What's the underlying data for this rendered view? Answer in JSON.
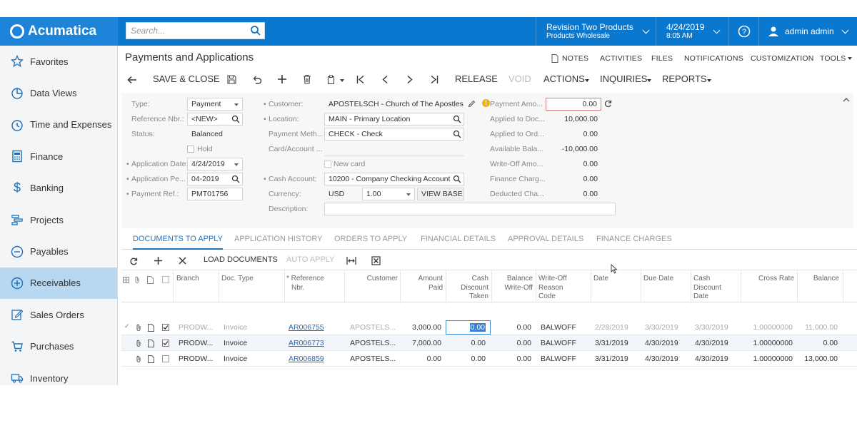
{
  "topbar": {
    "brand": "Acumatica",
    "search_placeholder": "Search...",
    "company_line1": "Revision Two Products",
    "company_line2": "Products Wholesale",
    "date_line1": "4/24/2019",
    "date_line2": "8:05 AM",
    "user": "admin admin"
  },
  "sidebar": {
    "items": [
      {
        "label": "Favorites",
        "icon": "star-icon"
      },
      {
        "label": "Data Views",
        "icon": "pie-chart-icon"
      },
      {
        "label": "Time and Expenses",
        "icon": "clock-icon"
      },
      {
        "label": "Finance",
        "icon": "calculator-icon"
      },
      {
        "label": "Banking",
        "icon": "dollar-icon"
      },
      {
        "label": "Projects",
        "icon": "projects-icon"
      },
      {
        "label": "Payables",
        "icon": "minus-circle-icon"
      },
      {
        "label": "Receivables",
        "icon": "plus-circle-icon"
      },
      {
        "label": "Sales Orders",
        "icon": "edit-icon"
      },
      {
        "label": "Purchases",
        "icon": "cart-icon"
      },
      {
        "label": "Inventory",
        "icon": "truck-icon"
      }
    ]
  },
  "page": {
    "title": "Payments and Applications",
    "utils": [
      "NOTES",
      "ACTIVITIES",
      "FILES",
      "NOTIFICATIONS",
      "CUSTOMIZATION",
      "TOOLS"
    ]
  },
  "toolbar": {
    "save_close": "SAVE & CLOSE",
    "release": "RELEASE",
    "void": "VOID",
    "actions": "ACTIONS",
    "inquiries": "INQUIRIES",
    "reports": "REPORTS"
  },
  "form": {
    "type_label": "Type:",
    "type_value": "Payment",
    "refnbr_label": "Reference Nbr.:",
    "refnbr_value": "<NEW>",
    "status_label": "Status:",
    "status_value": "Balanced",
    "hold_label": "Hold",
    "appdate_label": "Application Date:",
    "appdate_value": "4/24/2019",
    "appperiod_label": "Application Pe...",
    "appperiod_value": "04-2019",
    "payref_label": "Payment Ref.:",
    "payref_value": "PMT01756",
    "customer_label": "Customer:",
    "customer_value": "APOSTELSCH - Church of The Apostles",
    "location_label": "Location:",
    "location_value": "MAIN - Primary Location",
    "paymethod_label": "Payment Meth...",
    "paymethod_value": "CHECK - Check",
    "cardaccount_label": "Card/Account ...",
    "newcard_label": "New card",
    "cashaccount_label": "Cash Account:",
    "cashaccount_value": "10200 - Company Checking Account",
    "currency_label": "Currency:",
    "currency_value": "USD",
    "rate_value": "1.00",
    "viewbase": "VIEW BASE",
    "description_label": "Description:",
    "payamount_label": "Payment Amo...",
    "payamount_value": "0.00",
    "applieddoc_label": "Applied to Doc...",
    "applieddoc_value": "10,000.00",
    "appliedord_label": "Applied to Ord...",
    "appliedord_value": "0.00",
    "available_label": "Available Bala...",
    "available_value": "-10,000.00",
    "writeoff_label": "Write-Off Amo...",
    "writeoff_value": "0.00",
    "finance_label": "Finance Charg...",
    "finance_value": "0.00",
    "deducted_label": "Deducted Cha...",
    "deducted_value": "0.00"
  },
  "tabs": [
    "DOCUMENTS TO APPLY",
    "APPLICATION HISTORY",
    "ORDERS TO APPLY",
    "FINANCIAL DETAILS",
    "APPROVAL DETAILS",
    "FINANCE CHARGES"
  ],
  "grid_toolbar": {
    "load": "LOAD DOCUMENTS",
    "auto": "AUTO APPLY"
  },
  "grid": {
    "headers": {
      "branch": "Branch",
      "doctype": "Doc. Type",
      "refnbr1": "* Reference",
      "refnbr2": "Nbr.",
      "customer": "Customer",
      "amount1": "Amount",
      "amount2": "Paid",
      "cashdisc1": "Cash",
      "cashdisc2": "Discount",
      "cashdisc3": "Taken",
      "balwo1": "Balance",
      "balwo2": "Write-Off",
      "woreason1": "Write-Off",
      "woreason2": "Reason",
      "woreason3": "Code",
      "date": "Date",
      "duedate": "Due Date",
      "cdd1": "Cash",
      "cdd2": "Discount",
      "cdd3": "Date",
      "crossrate": "Cross Rate",
      "balance": "Balance"
    },
    "rows": [
      {
        "branch": "PRODW...",
        "doctype": "Invoice",
        "ref": "AR006755",
        "customer": "APOSTELS...",
        "amount": "3,000.00",
        "cashdisc": "0.00",
        "balwo": "0.00",
        "reason": "BALWOFF",
        "date": "2/28/2019",
        "due": "3/30/2019",
        "cdd": "3/30/2019",
        "rate": "1.00000000",
        "balance": "11,000.00",
        "checked": true
      },
      {
        "branch": "PRODW...",
        "doctype": "Invoice",
        "ref": "AR006773",
        "customer": "APOSTELS...",
        "amount": "7,000.00",
        "cashdisc": "0.00",
        "balwo": "0.00",
        "reason": "BALWOFF",
        "date": "3/31/2019",
        "due": "4/30/2019",
        "cdd": "4/30/2019",
        "rate": "1.00000000",
        "balance": "0.00",
        "checked": true
      },
      {
        "branch": "PRODW...",
        "doctype": "Invoice",
        "ref": "AR006859",
        "customer": "APOSTELS...",
        "amount": "0.00",
        "cashdisc": "0.00",
        "balwo": "0.00",
        "reason": "BALWOFF",
        "date": "3/31/2019",
        "due": "4/30/2019",
        "cdd": "4/30/2019",
        "rate": "1.00000000",
        "balance": "13,000.00",
        "checked": false
      }
    ]
  }
}
